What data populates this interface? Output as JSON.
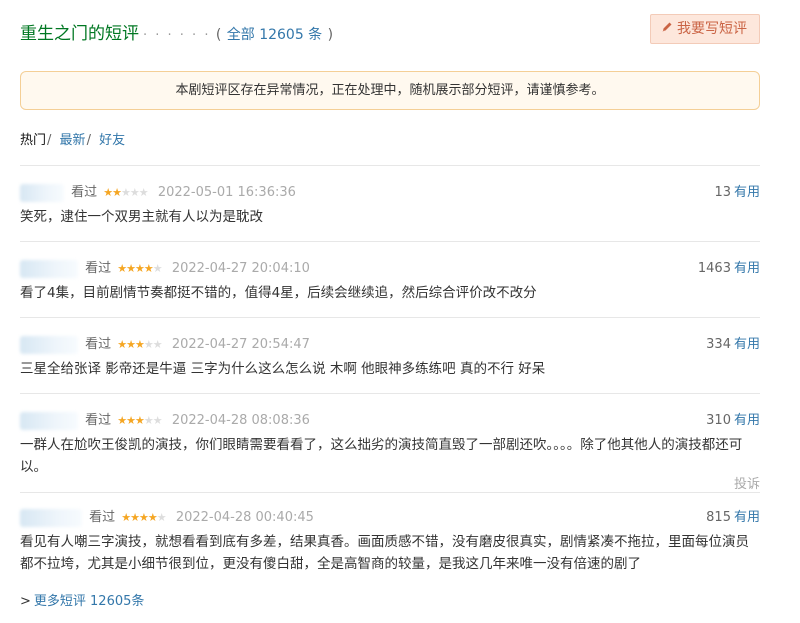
{
  "header": {
    "title": "重生之门的短评",
    "dots": "· · · · · ·",
    "paren_open": "(",
    "all_link": "全部 12605 条",
    "paren_close": ")",
    "write_button": "我要写短评",
    "write_icon": "pencil-icon"
  },
  "notice": "本剧短评区存在异常情况，正在处理中，随机展示部分短评，请谨慎参考。",
  "tabs": {
    "hot": "热门",
    "sep": "/",
    "newest": "最新",
    "friends": "好友"
  },
  "comments": [
    {
      "status": "看过",
      "rating": 2,
      "time": "2022-05-01 16:36:36",
      "votes": "13",
      "useful": "有用",
      "text": "笑死，逮住一个双男主就有人以为是耽改"
    },
    {
      "status": "看过",
      "rating": 4,
      "time": "2022-04-27 20:04:10",
      "votes": "1463",
      "useful": "有用",
      "text": "看了4集，目前剧情节奏都挺不错的，值得4星，后续会继续追，然后综合评价改不改分"
    },
    {
      "status": "看过",
      "rating": 3,
      "time": "2022-04-27 20:54:47",
      "votes": "334",
      "useful": "有用",
      "text": "三星全给张译 影帝还是牛逼 三字为什么这么怎么说 木啊 他眼神多练练吧 真的不行 好呆"
    },
    {
      "status": "看过",
      "rating": 3,
      "time": "2022-04-28 08:08:36",
      "votes": "310",
      "useful": "有用",
      "text": "一群人在尬吹王俊凯的演技，你们眼睛需要看看了，这么拙劣的演技简直毁了一部剧还吹。。。。除了他其他人的演技都还可以。",
      "report": "投诉"
    },
    {
      "status": "看过",
      "rating": 4,
      "time": "2022-04-28 00:40:45",
      "votes": "815",
      "useful": "有用",
      "text": "看见有人嘲三字演技，就想看看到底有多差，结果真香。画面质感不错，没有磨皮很真实，剧情紧凑不拖拉，里面每位演员都不拉垮，尤其是小细节很到位，更没有傻白甜，全是高智商的较量，是我这几年来唯一没有倍速的剧了"
    }
  ],
  "more": {
    "arrow": ">",
    "label": "更多短评 12605条"
  }
}
